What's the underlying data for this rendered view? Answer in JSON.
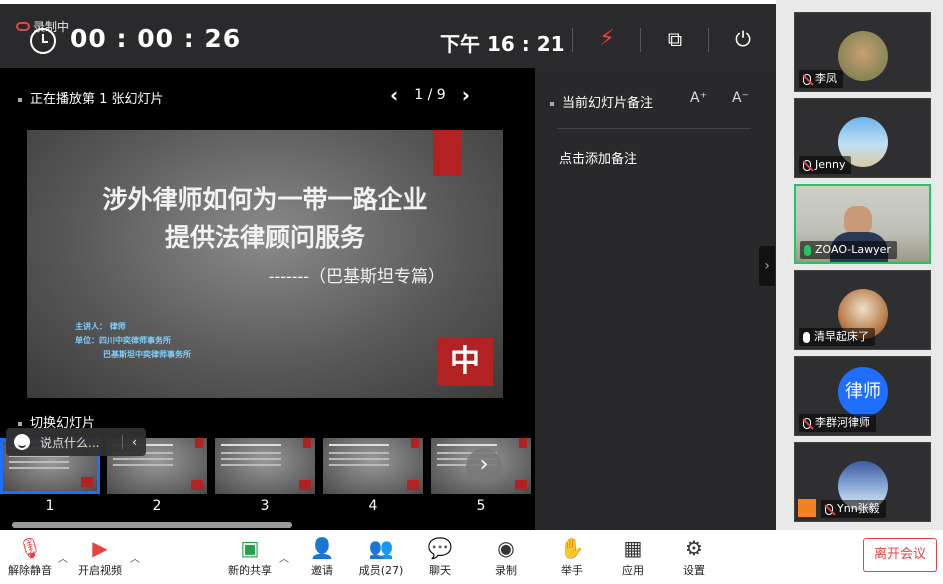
{
  "topbar": {
    "recording_label": "录制中",
    "timer": "00 : 00 : 26",
    "current_time": "下午 16 : 21"
  },
  "presenter": {
    "heading": "正在播放第 1 张幻灯片",
    "page_indicator": "1 / 9",
    "slide": {
      "title_line1": "涉外律师如何为一带一路企业",
      "title_line2": "提供法律顾问服务",
      "subtitle": "-------（巴基斯坦专篇）",
      "info_line1": "主讲人：             律师",
      "info_line2": "单位：四川中奕律师事务所",
      "info_line3": "巴基斯坦中奕律师事务所",
      "logo_glyph": "中"
    },
    "switch_heading": "切换幻灯片",
    "thumbnails": [
      "1",
      "2",
      "3",
      "4",
      "5"
    ],
    "chat_placeholder": "说点什么..."
  },
  "notes": {
    "heading": "当前幻灯片备注",
    "font_increase": "A⁺",
    "font_decrease": "A⁻",
    "add_note": "点击添加备注"
  },
  "participants": [
    {
      "name": "李凤",
      "mic": "muted"
    },
    {
      "name": "Jenny",
      "mic": "muted"
    },
    {
      "name": "ZOAO-Lawyer",
      "mic": "speaking"
    },
    {
      "name": "清早起床了",
      "mic": "on"
    },
    {
      "name": "李群河律师",
      "mic": "muted",
      "avatar_text": "律师"
    },
    {
      "name": "Ynn张毅",
      "mic": "muted"
    }
  ],
  "toolbar": {
    "unmute": "解除静音",
    "start_video": "开启视频",
    "new_share": "新的共享",
    "invite": "邀请",
    "members": "成员(27)",
    "chat": "聊天",
    "record": "录制",
    "raise_hand": "举手",
    "apps": "应用",
    "settings": "设置",
    "leave": "离开会议"
  },
  "colors": {
    "accent_blue": "#1e6fff",
    "danger_red": "#e84343",
    "speaking_green": "#22c55e",
    "slide_red": "#b22222"
  }
}
